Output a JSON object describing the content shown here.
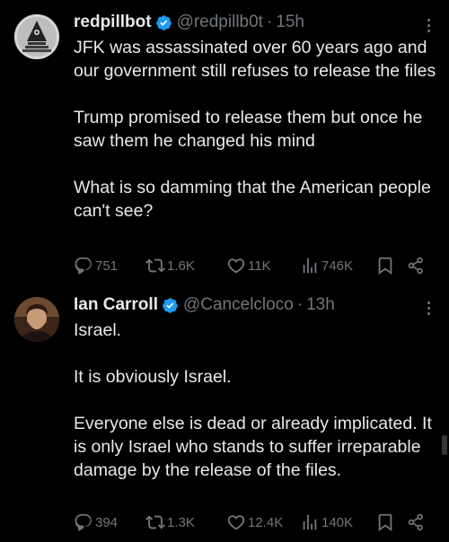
{
  "tweets": [
    {
      "display_name": "redpillbot",
      "handle": "@redpillb0t",
      "separator": "·",
      "time": "15h",
      "paragraphs": [
        "JFK was assassinated over 60 years ago and our government still refuses to release the files",
        "Trump promised to release them but once he saw them he changed his mind",
        "What is so damming that the American people can't see?"
      ],
      "replies": "751",
      "reposts": "1.6K",
      "likes": "11K",
      "views": "746K"
    },
    {
      "display_name": "Ian Carroll",
      "handle": "@Cancelcloco",
      "separator": "·",
      "time": "13h",
      "paragraphs": [
        "Israel.",
        "It is obviously Israel.",
        "Everyone else is dead or already implicated. It is only Israel who stands to suffer irreparable damage by the release of the files."
      ],
      "replies": "394",
      "reposts": "1.3K",
      "likes": "12.4K",
      "views": "140K"
    }
  ],
  "icons": {
    "verified": "verified-badge-icon",
    "more": "more-dots-icon",
    "reply": "reply-icon",
    "repost": "repost-icon",
    "like": "like-icon",
    "views": "views-icon",
    "bookmark": "bookmark-icon",
    "share": "share-icon"
  },
  "colors": {
    "background": "#000000",
    "text": "#e7e9ea",
    "secondary": "#71767b",
    "verified": "#1d9bf0"
  }
}
